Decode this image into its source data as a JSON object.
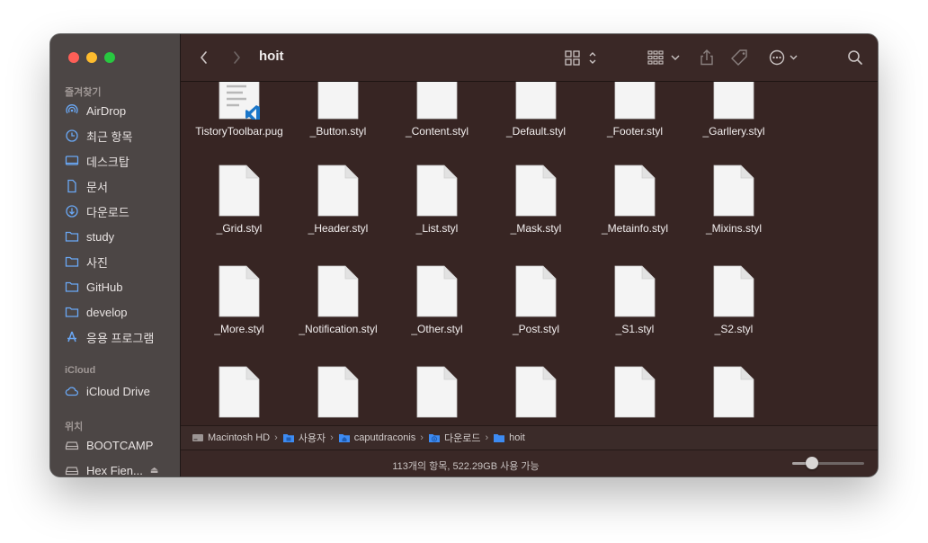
{
  "window": {
    "title": "hoit"
  },
  "sidebar": {
    "sections": [
      {
        "title": "즐겨찾기",
        "items": [
          {
            "label": "AirDrop",
            "icon": "airdrop-icon"
          },
          {
            "label": "최근 항목",
            "icon": "clock-icon"
          },
          {
            "label": "데스크탑",
            "icon": "desktop-icon"
          },
          {
            "label": "문서",
            "icon": "document-icon"
          },
          {
            "label": "다운로드",
            "icon": "download-icon"
          },
          {
            "label": "study",
            "icon": "folder-icon"
          },
          {
            "label": "사진",
            "icon": "folder-icon"
          },
          {
            "label": "GitHub",
            "icon": "folder-icon"
          },
          {
            "label": "develop",
            "icon": "folder-icon"
          },
          {
            "label": "응용 프로그램",
            "icon": "applications-icon"
          }
        ]
      },
      {
        "title": "iCloud",
        "items": [
          {
            "label": "iCloud Drive",
            "icon": "cloud-icon"
          }
        ]
      },
      {
        "title": "위치",
        "items": [
          {
            "label": "BOOTCAMP",
            "icon": "disk-icon"
          },
          {
            "label": "Hex Fien...",
            "icon": "disk-icon"
          }
        ]
      }
    ]
  },
  "files": [
    "TistoryToolbar.pug",
    "_Button.styl",
    "_Content.styl",
    "_Default.styl",
    "_Footer.styl",
    "_Garllery.styl",
    "_Grid.styl",
    "_Header.styl",
    "_List.styl",
    "_Mask.styl",
    "_Metainfo.styl",
    "_Mixins.styl",
    "_More.styl",
    "_Notification.styl",
    "_Other.styl",
    "_Post.styl",
    "_S1.styl",
    "_S2.styl",
    "",
    "",
    "",
    "",
    "",
    ""
  ],
  "pathbar": [
    {
      "label": "Macintosh HD",
      "icon": "hard-drive-icon"
    },
    {
      "label": "사용자",
      "icon": "folder-icon"
    },
    {
      "label": "caputdraconis",
      "icon": "home-folder-icon"
    },
    {
      "label": "다운로드",
      "icon": "downloads-folder-icon"
    },
    {
      "label": "hoit",
      "icon": "folder-icon"
    }
  ],
  "status": {
    "text": "113개의 항목, 522.29GB 사용 가능",
    "icon_size_level": 0.2
  },
  "colors": {
    "window_bg": "#372523",
    "sidebar_bg": "#4c4645",
    "accent": "#3d8bf2"
  }
}
